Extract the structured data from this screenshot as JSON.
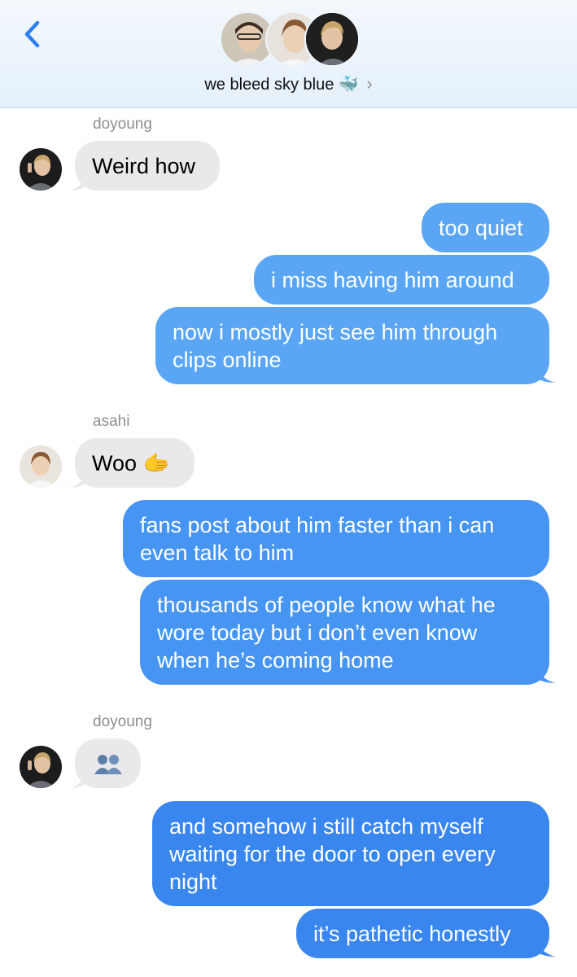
{
  "header": {
    "group_name": "we bleed sky blue",
    "whale_emoji": "🐳",
    "chevron": "›",
    "back_icon": "chevron-left-icon"
  },
  "colors": {
    "accent": "#2f7ff0",
    "incoming_bubble": "#e9e9eb",
    "outgoing_light": "#5aa6f5",
    "outgoing_mid": "#4795f2",
    "outgoing_deep": "#3a86ef"
  },
  "messages": [
    {
      "sender": "doyoung",
      "text": "Weird how",
      "direction": "in"
    },
    {
      "text": "too quiet",
      "direction": "out"
    },
    {
      "text": "i miss having him around",
      "direction": "out"
    },
    {
      "text": "now i mostly just see him through clips online",
      "direction": "out"
    },
    {
      "sender": "asahi",
      "text": "Woo 🫱",
      "direction": "in"
    },
    {
      "text": "fans post about him faster than i can even talk to him",
      "direction": "out"
    },
    {
      "text": "thousands of people know what he wore today but i don’t even know when he’s coming home",
      "direction": "out"
    },
    {
      "sender": "doyoung",
      "text": "",
      "sticker": "two-people-emoji",
      "direction": "in"
    },
    {
      "text": "and somehow i still catch myself waiting for the door to open every night",
      "direction": "out"
    },
    {
      "text": "it’s pathetic honestly",
      "direction": "out"
    }
  ]
}
